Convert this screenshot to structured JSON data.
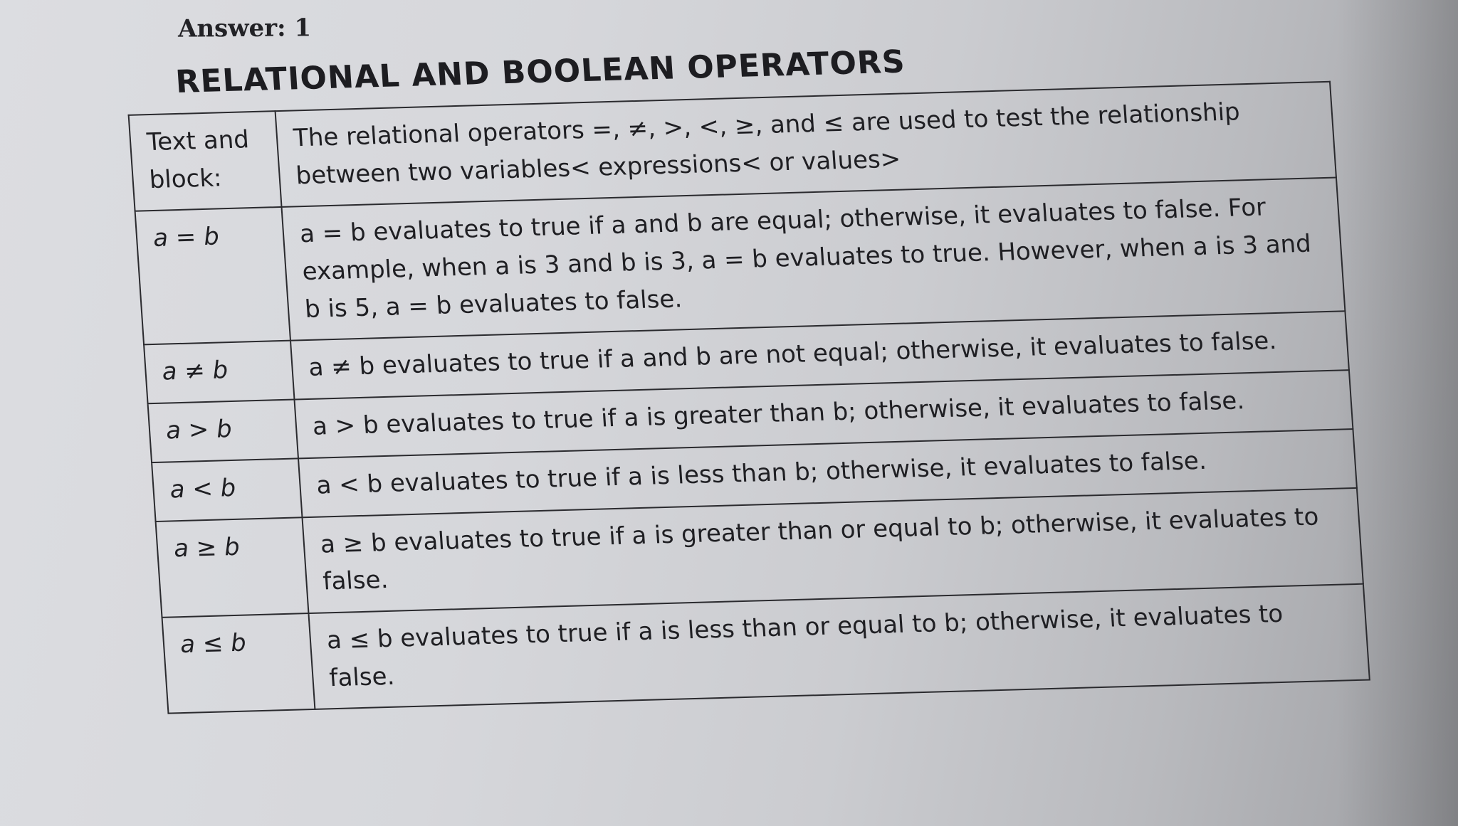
{
  "answer": "Answer: 1",
  "section_title": "RELATIONAL AND BOOLEAN OPERATORS",
  "header_row": {
    "col1": "Text and block:",
    "col2": "The relational operators =, ≠, >, <, ≥, and ≤ are used to test the relationship between two variables< expressions< or values>"
  },
  "rows": [
    {
      "operator": "a = b",
      "description": "a = b evaluates to true if a and b are equal; otherwise, it evaluates to false. For example, when a is 3 and b is 3, a = b evaluates to true. However, when a is 3 and b is 5, a = b evaluates to false."
    },
    {
      "operator": "a ≠ b",
      "description": "a ≠ b evaluates to true if a and b are not equal; otherwise, it evaluates to false."
    },
    {
      "operator": "a > b",
      "description": "a > b evaluates to true if a is greater than b; otherwise, it evaluates to false."
    },
    {
      "operator": "a < b",
      "description": "a < b evaluates to true if a is less than b; otherwise, it evaluates to false."
    },
    {
      "operator": "a ≥ b",
      "description": "a ≥ b evaluates to true if a is greater than or equal to b; otherwise, it evaluates to false."
    },
    {
      "operator": "a ≤ b",
      "description": "a ≤ b evaluates to true if a is less than or equal to b; otherwise, it evaluates to false."
    }
  ]
}
